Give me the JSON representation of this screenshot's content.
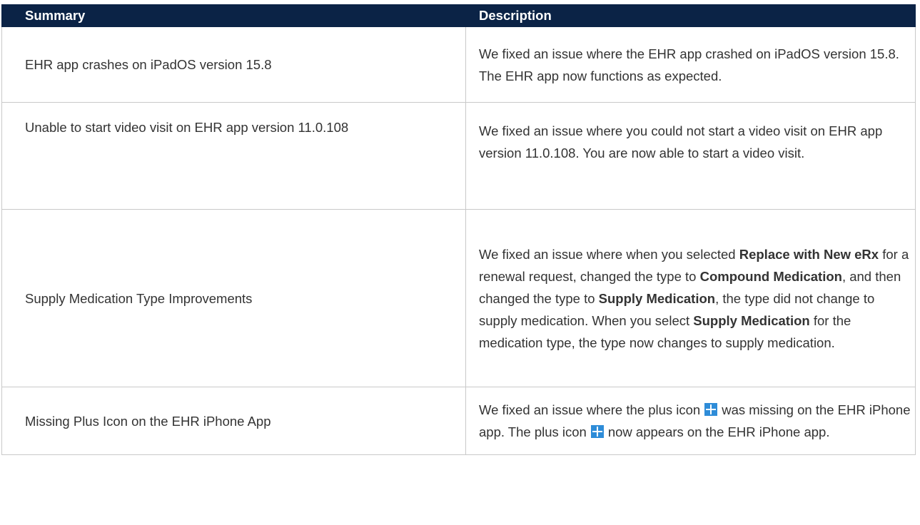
{
  "table": {
    "headers": {
      "summary": "Summary",
      "description": "Description"
    },
    "rows": [
      {
        "summary": "EHR app crashes on iPadOS version 15.8",
        "description": "We fixed an issue where the EHR app crashed on iPadOS version 15.8. The EHR app now functions as expected."
      },
      {
        "summary": "Unable to start video visit on EHR app version 11.0.108",
        "description": "We fixed an issue where you could not start a video visit on EHR app version 11.0.108. You are now able to start a video visit."
      },
      {
        "summary": "Supply Medication Type Improvements",
        "description": {
          "t1": "We fixed an issue where when you selected ",
          "b1": "Replace with New eRx",
          "t2": " for a renewal request, changed the type to ",
          "b2": "Compound Medication",
          "t3": ", and then changed the type to ",
          "b3": "Supply Medication",
          "t4": ", the type did not change to supply medication. When you select ",
          "b4": "Supply Medication",
          "t5": " for the medication type, the type now changes to supply medication."
        }
      },
      {
        "summary": "Missing Plus Icon on the EHR iPhone App",
        "description": {
          "t1": "We fixed an issue where the plus icon",
          "t2": "was missing on  the EHR iPhone app. The plus icon",
          "t3": "now appears on the EHR iPhone app."
        }
      }
    ]
  },
  "colors": {
    "header_bg": "#0b2346",
    "header_text": "#ffffff",
    "body_text": "#333333",
    "border": "#c9c9c9",
    "icon_accent": "#2e8cd8"
  },
  "icons": {
    "plus": "plus-icon"
  }
}
